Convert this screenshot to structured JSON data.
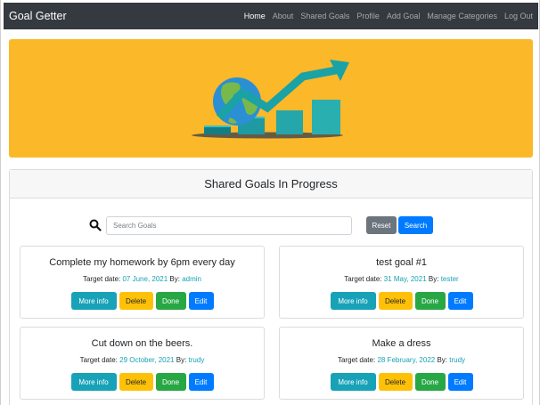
{
  "navbar": {
    "brand": "Goal Getter",
    "links": [
      "Home",
      "About",
      "Shared Goals",
      "Profile",
      "Add Goal",
      "Manage Categories",
      "Log Out"
    ]
  },
  "hero": {
    "image": "growth-chart-globe-illustration"
  },
  "shared_goals": {
    "header": "Shared Goals In Progress",
    "search_placeholder": "Search Goals",
    "reset_label": "Reset",
    "search_label": "Search",
    "target_label": "Target date:",
    "by_label": "By:",
    "buttons": {
      "more_info": "More info",
      "delete": "Delete",
      "done": "Done",
      "edit": "Edit"
    },
    "goals": [
      {
        "title": "Complete my homework by 6pm every day",
        "date": "07 June, 2021",
        "user": "admin"
      },
      {
        "title": "test goal #1",
        "date": "31 May, 2021",
        "user": "tester"
      },
      {
        "title": "Cut down on the beers.",
        "date": "29 October, 2021",
        "user": "trudy"
      },
      {
        "title": "Make a dress",
        "date": "28 February, 2022",
        "user": "trudy"
      }
    ]
  },
  "colors": {
    "navbar": "#343a40",
    "hero": "#fbb829",
    "info": "#17a2b8",
    "delete": "#ffc107",
    "done": "#28a745",
    "edit": "#007bff",
    "reset": "#6c757d"
  }
}
